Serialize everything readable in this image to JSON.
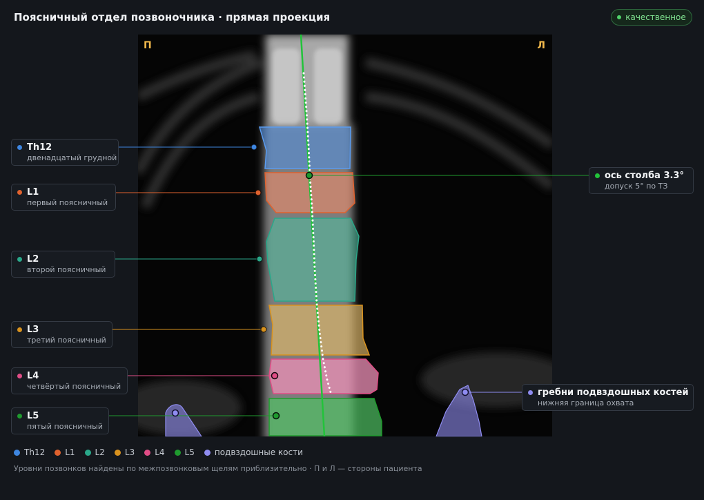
{
  "header": {
    "title": "Поясничный отдел позвоночника · прямая проекция",
    "badge": "качественное"
  },
  "viewer": {
    "left_mark": "П",
    "right_mark": "Л"
  },
  "labels": [
    {
      "key": "th12",
      "name": "Th12",
      "sub": "двенадцатый грудной",
      "color": "#3e86e0"
    },
    {
      "key": "l1",
      "name": "L1",
      "sub": "первый поясничный",
      "color": "#e0622e"
    },
    {
      "key": "l2",
      "name": "L2",
      "sub": "второй поясничный",
      "color": "#2aa88a"
    },
    {
      "key": "l3",
      "name": "L3",
      "sub": "третий поясничный",
      "color": "#d8921e"
    },
    {
      "key": "l4",
      "name": "L4",
      "sub": "четвёртый поясничный",
      "color": "#e04d86"
    },
    {
      "key": "l5",
      "name": "L5",
      "sub": "пятый поясничный",
      "color": "#1f9a2e"
    }
  ],
  "axis_label": {
    "name": "ось столба 3.3°",
    "sub": "допуск 5° по ТЗ",
    "color": "#1f9a2e"
  },
  "iliac_label": {
    "name": "гребни подвздошных костей",
    "sub": "нижняя граница охвата",
    "color": "#8f8cf0"
  },
  "legend": [
    {
      "label": "Th12",
      "color": "#3e86e0"
    },
    {
      "label": "L1",
      "color": "#e0622e"
    },
    {
      "label": "L2",
      "color": "#2aa88a"
    },
    {
      "label": "L3",
      "color": "#d8921e"
    },
    {
      "label": "L4",
      "color": "#e04d86"
    },
    {
      "label": "L5",
      "color": "#1f9a2e"
    },
    {
      "label": "подвздошные кости",
      "color": "#8f8cf0"
    }
  ],
  "footnote": "Уровни позвонков найдены по межпозвонковым щелям приблизительно · П и Л — стороны пациента"
}
